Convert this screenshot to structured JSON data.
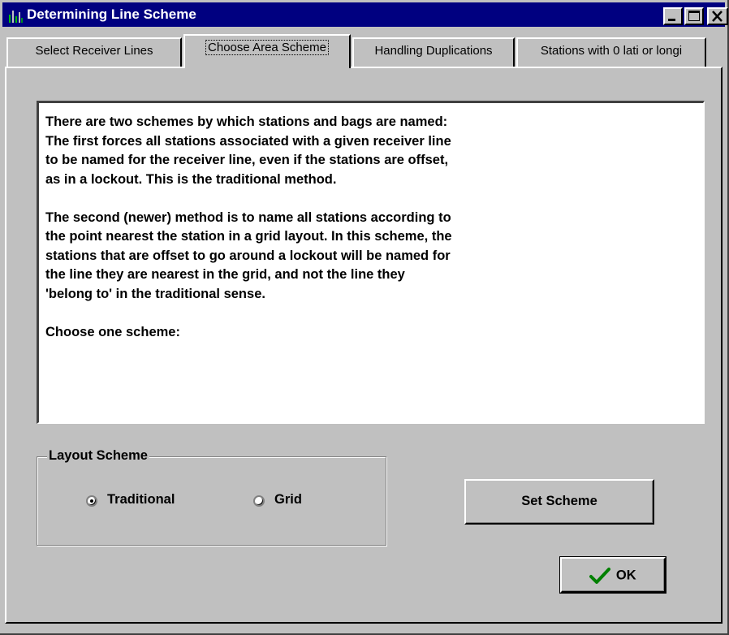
{
  "window": {
    "title": "Determining Line Scheme",
    "colors": {
      "titlebar": "#000080",
      "face": "#c0c0c0",
      "text": "#000000"
    },
    "controls": {
      "minimize_icon": "minimize-icon",
      "maximize_icon": "maximize-icon",
      "close_icon": "close-icon"
    }
  },
  "tabs": [
    {
      "label": "Select Receiver Lines",
      "active": false
    },
    {
      "label": "Choose Area Scheme",
      "active": true
    },
    {
      "label": "Handling Duplications",
      "active": false
    },
    {
      "label": "Stations with 0 lati or longi",
      "active": false
    }
  ],
  "description": {
    "paragraphs": [
      "There are two schemes by which stations and bags are named:\nThe first forces all stations associated with a given receiver line\nto be named for the receiver line, even if the stations are offset,\nas in a lockout.  This is the traditional method.",
      "The second (newer) method is to name all stations according to\nthe point nearest the station in a grid layout.  In this scheme, the\nstations that are offset to go around a lockout will be named for\nthe line they are nearest in the grid, and not the line they\n'belong to' in the traditional sense.",
      "Choose one scheme:"
    ]
  },
  "layout_scheme": {
    "label": "Layout Scheme",
    "options": [
      {
        "label": "Traditional",
        "selected": true
      },
      {
        "label": "Grid",
        "selected": false
      }
    ]
  },
  "buttons": {
    "set_scheme": "Set Scheme",
    "ok": "OK",
    "ok_icon": "checkmark-icon"
  }
}
